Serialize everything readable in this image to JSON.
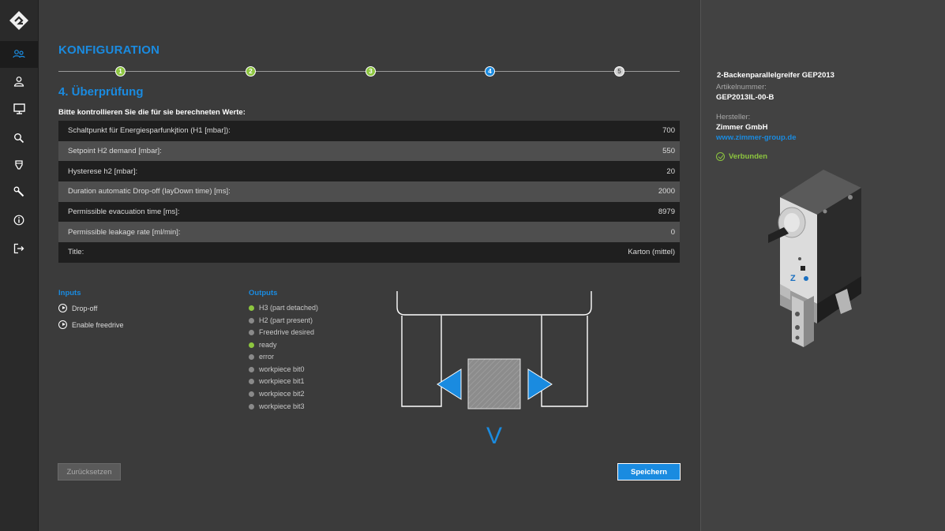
{
  "sidebar": {
    "items": [
      {
        "icon": "users-icon",
        "active": true
      },
      {
        "icon": "user-icon",
        "active": false
      },
      {
        "icon": "monitor-icon",
        "active": false
      },
      {
        "icon": "search-icon",
        "active": false
      },
      {
        "icon": "gripper-icon",
        "active": false
      },
      {
        "icon": "wrench-icon",
        "active": false
      },
      {
        "icon": "info-icon",
        "active": false
      },
      {
        "icon": "logout-icon",
        "active": false
      }
    ]
  },
  "main": {
    "title": "KONFIGURATION",
    "steps": [
      {
        "label": "1",
        "state": "done"
      },
      {
        "label": "2",
        "state": "done"
      },
      {
        "label": "3",
        "state": "done"
      },
      {
        "label": "4",
        "state": "current"
      },
      {
        "label": "5",
        "state": "todo"
      }
    ],
    "step_title": "4. Überprüfung",
    "instruction": "Bitte kontrollieren Sie die für sie berechneten Werte:",
    "rows": [
      {
        "label": "Schaltpunkt für Energiesparfunkjtion (H1 [mbar]):",
        "value": "700"
      },
      {
        "label": "Setpoint H2 demand [mbar]:",
        "value": "550"
      },
      {
        "label": "Hysterese h2  [mbar]:",
        "value": "20"
      },
      {
        "label": "Duration automatic Drop-off (layDown time) [ms]:",
        "value": "2000"
      },
      {
        "label": "Permissible evacuation time [ms]:",
        "value": "8979"
      },
      {
        "label": "Permissible leakage rate [ml/min]:",
        "value": "0"
      },
      {
        "label": "Title:",
        "value": "Karton (mittel)"
      }
    ],
    "inputs_heading": "Inputs",
    "inputs": [
      "Drop-off",
      "Enable freedrive"
    ],
    "outputs_heading": "Outputs",
    "outputs": [
      {
        "label": "H3 (part detached)",
        "on": true
      },
      {
        "label": "H2 (part present)",
        "on": false
      },
      {
        "label": "Freedrive desired",
        "on": false
      },
      {
        "label": "ready",
        "on": true
      },
      {
        "label": "error",
        "on": false
      },
      {
        "label": "workpiece bit0",
        "on": false
      },
      {
        "label": "workpiece bit1",
        "on": false
      },
      {
        "label": "workpiece bit2",
        "on": false
      },
      {
        "label": "workpiece bit3",
        "on": false
      }
    ],
    "diagram_letter": "V",
    "reset_label": "Zurücksetzen",
    "save_label": "Speichern"
  },
  "product": {
    "title": "2-Backenparallelgreifer GEP2013",
    "article_label": "Artikelnummer:",
    "article_value": "GEP2013IL-00-B",
    "manufacturer_label": "Hersteller:",
    "manufacturer_value": "Zimmer GmbH",
    "website": "www.zimmer-group.de",
    "status": "Verbunden"
  },
  "colors": {
    "accent": "#1a8be0",
    "success": "#8dc63f"
  }
}
